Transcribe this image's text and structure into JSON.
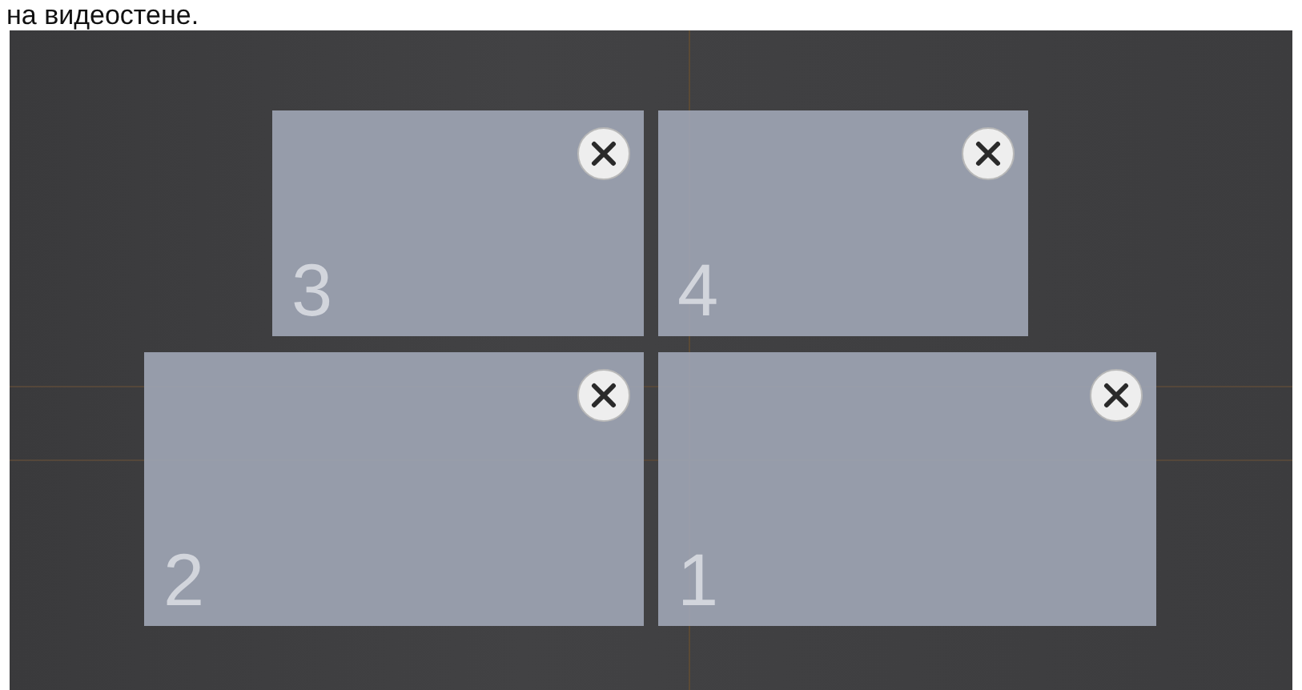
{
  "caption": "на видеостене.",
  "tiles": [
    {
      "number": "3"
    },
    {
      "number": "4"
    },
    {
      "number": "2"
    },
    {
      "number": "1"
    }
  ]
}
